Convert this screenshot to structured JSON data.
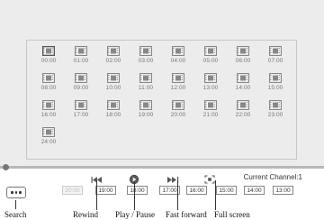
{
  "hours": [
    "00:00",
    "01:00",
    "02:00",
    "03:00",
    "04:00",
    "05:00",
    "06:00",
    "07:00",
    "08:00",
    "09:00",
    "10:00",
    "11:00",
    "12:00",
    "13:00",
    "14:00",
    "15:00",
    "16:00",
    "17:00",
    "18:00",
    "19:00",
    "20:00",
    "21:00",
    "22:00",
    "23:00",
    "24:00"
  ],
  "selected_hour_index": 0,
  "timeline_progress": 0.0,
  "channel": {
    "text": "Current Channel:1"
  },
  "time_buttons": {
    "prev": "20:00",
    "b1": "19:00",
    "b2": "18:00",
    "b3": "17:00",
    "b4": "16:00",
    "b5": "15:00",
    "b6": "14:00",
    "b7": "13:00"
  },
  "icons": {
    "search": "more-dots-icon",
    "rewind": "rewind-icon",
    "play_pause": "play-icon",
    "fast_forward": "fast-forward-icon",
    "full_screen": "fullscreen-icon"
  },
  "annotations": {
    "search": "Search",
    "rewind": "Rewind",
    "play_pause": "Play / Pause",
    "fast_forward": "Fast forward",
    "full_screen": "Full screen"
  }
}
